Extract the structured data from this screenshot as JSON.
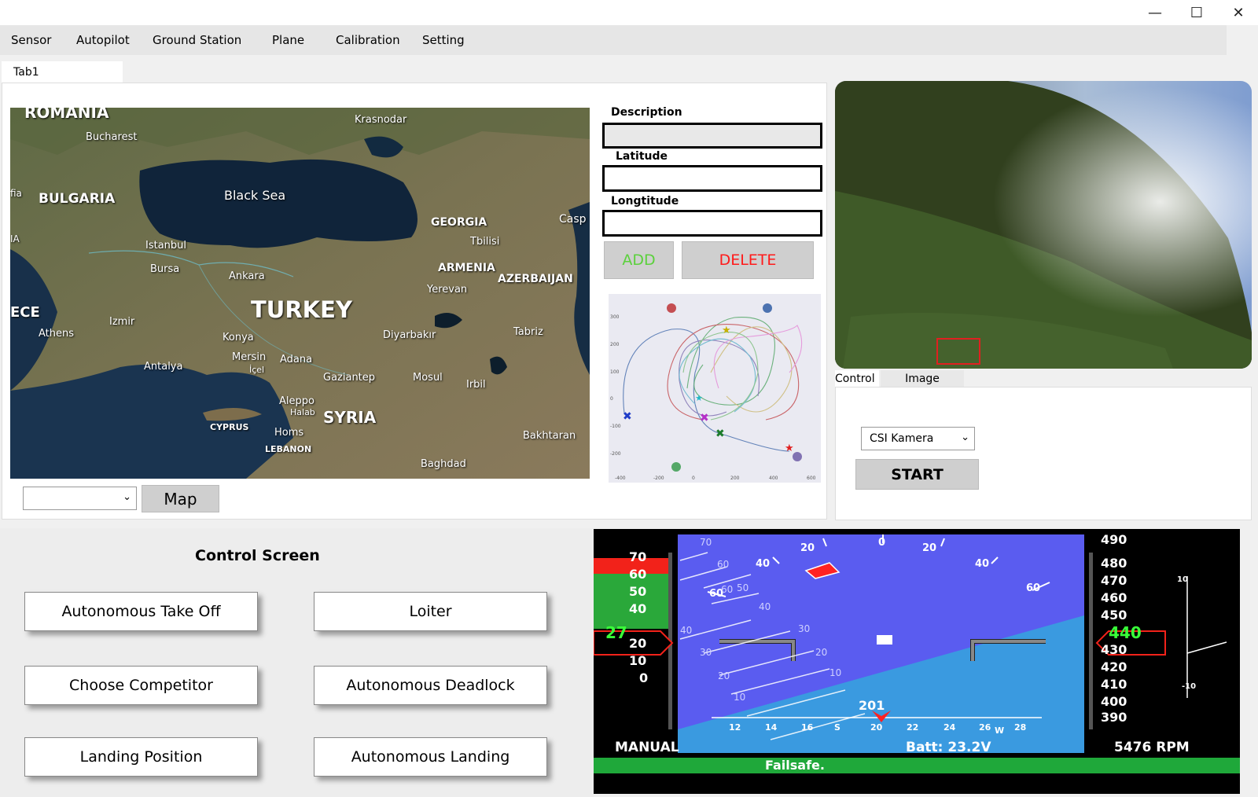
{
  "window": {
    "minimize": "—",
    "maximize": "☐",
    "close": "✕"
  },
  "menu": {
    "items": [
      "Sensor",
      "Autopilot",
      "Ground Station",
      "Plane",
      "Calibration",
      "Setting"
    ]
  },
  "tabs": {
    "tab1": "Tab1"
  },
  "map": {
    "labels": {
      "romania": "ROMANIA",
      "bucharest": "Bucharest",
      "fia": "fia",
      "bulgaria": "BULGARIA",
      "ia": "IA",
      "black_sea": "Black Sea",
      "krasnodar": "Krasnodar",
      "georgia": "GEORGIA",
      "casp": "Casp",
      "tbilisi": "Tbilisi",
      "istanbul": "Istanbul",
      "bursa": "Bursa",
      "ankara": "Ankara",
      "armenia": "ARMENIA",
      "azerbaijan": "AZERBAIJAN",
      "yerevan": "Yerevan",
      "ece": "ECE",
      "izmir": "Izmir",
      "athens": "Athens",
      "turkey": "TURKEY",
      "konya": "Konya",
      "tabriz": "Tabriz",
      "diyarbakir": "Diyarbakır",
      "antalya": "Antalya",
      "mersin": "Mersin",
      "icel": "İçel",
      "adana": "Adana",
      "gaziantep": "Gaziantep",
      "mosul": "Mosul",
      "irbil": "Irbil",
      "aleppo": "Aleppo",
      "halab": "Halab",
      "cyprus": "CYPRUS",
      "syria": "SYRIA",
      "homs": "Homs",
      "lebanon": "LEBANON",
      "bakhtaran": "Bakhtaran",
      "baghdad": "Baghdad"
    },
    "dropdown_value": "",
    "map_button": "Map"
  },
  "form": {
    "description_label": "Description",
    "latitude_label": "Latitude",
    "longitude_label": "Longtitude",
    "description_value": "",
    "latitude_value": "",
    "longitude_value": "",
    "add_label": "ADD",
    "delete_label": "DELETE",
    "add_color": "#5bd13c",
    "delete_color": "#ff1a1a"
  },
  "chart_data": {
    "type": "scatter",
    "xticks": [
      "-400",
      "-200",
      "0",
      "200",
      "400",
      "600"
    ],
    "yticks": [
      "300",
      "200",
      "100",
      "0",
      "-100",
      "-200"
    ],
    "xlim": [
      -400,
      600
    ],
    "ylim": [
      -230,
      330
    ]
  },
  "camera": {
    "tab_control": "Control",
    "tab_image": "Image",
    "camera_select": "CSI Kamera",
    "start_label": "START"
  },
  "control_screen": {
    "title": "Control Screen",
    "buttons": {
      "takeoff": "Autonomous Take Off",
      "loiter": "Loiter",
      "competitor": "Choose Competitor",
      "deadlock": "Autonomous Deadlock",
      "landing_position": "Landing Position",
      "landing": "Autonomous Landing"
    }
  },
  "hud": {
    "speed_tape": [
      "70",
      "60",
      "50",
      "40",
      "20",
      "10",
      "0"
    ],
    "speed_current": "27",
    "alt_tape": [
      "490",
      "480",
      "470",
      "460",
      "450",
      "430",
      "420",
      "410",
      "400",
      "390"
    ],
    "alt_current": "440",
    "vsi_top": "10",
    "vsi_bottom": "-10",
    "roll_labels": [
      "20",
      "0",
      "20",
      "40",
      "40",
      "60",
      "60"
    ],
    "pitch_labels": [
      "70",
      "60",
      "50",
      "40",
      "30",
      "20",
      "10",
      "40",
      "30",
      "20",
      "10",
      "60"
    ],
    "heading_labels": [
      "12",
      "14",
      "16",
      "S",
      "20",
      "22",
      "24",
      "26",
      "W",
      "28"
    ],
    "heading_current": "201",
    "mode": "MANUAL",
    "battery": "Batt: 23.2V",
    "rpm": "5476 RPM",
    "failsafe": "Failsafe."
  }
}
